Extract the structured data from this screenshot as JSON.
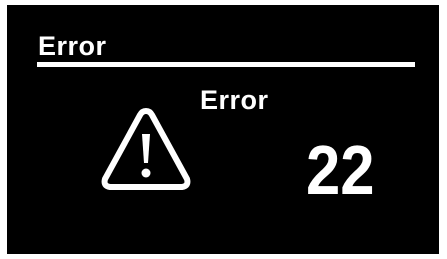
{
  "header": {
    "title": "Error"
  },
  "main": {
    "label": "Error",
    "code": "22",
    "icon": "warning-icon"
  },
  "colors": {
    "screen_background": "#000000",
    "foreground": "#ffffff"
  }
}
